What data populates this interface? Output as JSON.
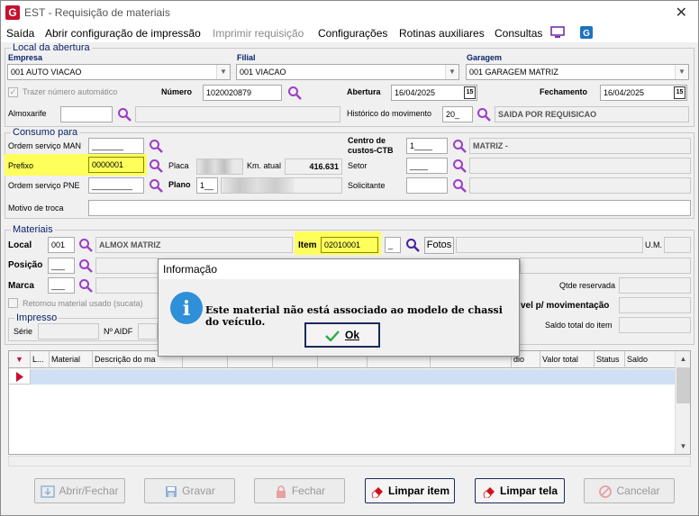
{
  "window": {
    "title": "EST - Requisição de materiais",
    "close_label": "✕"
  },
  "menu": {
    "saida": "Saída",
    "abrir_config": "Abrir configuração de impressão",
    "imprimir": "Imprimir requisição",
    "configuracoes": "Configurações",
    "rotinas": "Rotinas auxiliares",
    "consultas": "Consultas"
  },
  "local_abertura": {
    "title": "Local da abertura",
    "empresa_label": "Empresa",
    "empresa_value": "001 AUTO VIACAO",
    "filial_label": "Filial",
    "filial_value": "001 VIACAO",
    "garagem_label": "Garagem",
    "garagem_value": "001 GARAGEM MATRIZ",
    "trazer_label": "Trazer número automático",
    "numero_label": "Número",
    "numero_value": "1020020879",
    "abertura_label": "Abertura",
    "abertura_value": "16/04/2025",
    "fechamento_label": "Fechamento",
    "fechamento_value": "16/04/2025",
    "cal_label": "15",
    "almoxarife_label": "Almoxarife",
    "historico_label": "Histórico do movimento",
    "historico_code": "20_",
    "historico_desc": "SAIDA POR REQUISICAO"
  },
  "consumo": {
    "title": "Consumo para",
    "ordem_man_label": "Ordem serviço MAN",
    "ordem_man_value": "_______",
    "prefixo_label": "Prefixo",
    "prefixo_value": "0000001",
    "ordem_pne_label": "Ordem serviço PNE",
    "ordem_pne_value": "_________",
    "placa_label": "Placa",
    "km_label": "Km. atual",
    "km_value": "416.631",
    "plano_label": "Plano",
    "plano_value": "1__",
    "centro_label_1": "Centro de",
    "centro_label_2": "custos-CTB",
    "centro_value": "1____",
    "centro_desc": "MATRIZ -",
    "setor_label": "Setor",
    "setor_value": "____",
    "solicitante_label": "Solicitante",
    "motivo_label": "Motivo de troca"
  },
  "materiais": {
    "title": "Materiais",
    "local_label": "Local",
    "local_value": "001",
    "local_desc": "ALMOX MATRIZ",
    "item_label": "Item",
    "item_value": "02010001",
    "item_extra": "_",
    "fotos_label": "Fotos",
    "um_label": "U.M.",
    "posicao_label": "Posição",
    "posicao_value": "___",
    "marca_label": "Marca",
    "marca_value": "___",
    "qtde_label": "Qtde reservada",
    "disp_label": "vel p/ movimentação",
    "retornou_label": "Retornou material usado (sucata)",
    "saldo_label": "Saldo total do item",
    "impresso_title": "Impresso",
    "serie_label": "Série",
    "aidf_label": "Nº AIDF"
  },
  "grid": {
    "columns": [
      "L...",
      "Material",
      "Descrição do ma",
      "",
      "",
      "",
      "",
      "",
      "",
      "dio",
      "Valor total",
      "Status",
      "Saldo"
    ]
  },
  "buttons": {
    "abrir": "Abrir/Fechar",
    "gravar": "Gravar",
    "fechar": "Fechar",
    "limpar_item": "Limpar item",
    "limpar_tela": "Limpar tela",
    "cancelar": "Cancelar"
  },
  "dialog": {
    "title": "Informação",
    "message": "Este material não está associado ao modelo de chassi do veículo.",
    "ok_label": "Ok",
    "info_glyph": "i"
  },
  "colors": {
    "highlight": "#ffff5c",
    "search_icon": "#9b3fc4",
    "grid_selection": "#cfe0f4",
    "dialog_info": "#2f8fd8"
  }
}
